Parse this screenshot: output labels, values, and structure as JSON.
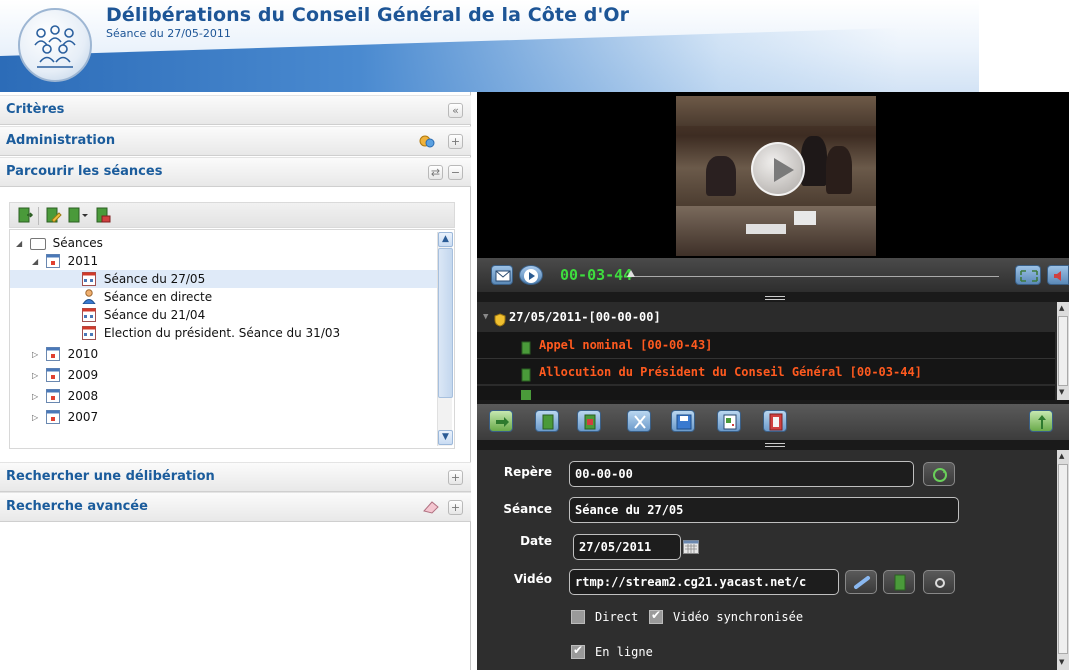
{
  "header": {
    "title": "Délibérations du Conseil Général de la Côte d'Or",
    "subtitle": "Séance du 27/05-2011"
  },
  "left_panel": {
    "criteres": {
      "title": "Critères",
      "collapse_icon": "double-chevron-left-icon"
    },
    "administration": {
      "title": "Administration"
    },
    "parcourir": {
      "title": "Parcourir les séances"
    },
    "tree": {
      "root": "Séances",
      "items": [
        {
          "label": "2011",
          "expanded": true
        },
        {
          "label": "Séance du 27/05",
          "selected": true
        },
        {
          "label": "Séance en directe"
        },
        {
          "label": "Séance du 21/04"
        },
        {
          "label": "Election du président. Séance du 31/03"
        },
        {
          "label": "2010"
        },
        {
          "label": "2009"
        },
        {
          "label": "2008"
        },
        {
          "label": "2007"
        }
      ]
    },
    "rechercher": {
      "title": "Rechercher une délibération"
    },
    "avancee": {
      "title": "Recherche avancée"
    }
  },
  "player": {
    "timecode": "00-03-44"
  },
  "marker_list": {
    "rows": [
      {
        "label": "27/05/2011-[00-00-00]",
        "color": "#ffffff"
      },
      {
        "label": "Appel nominal  [00-00-43]",
        "color": "#ff5a1f"
      },
      {
        "label": "Allocution du Président du Conseil Général  [00-03-44]",
        "color": "#ff5a1f"
      }
    ]
  },
  "form": {
    "repere_label": "Repère",
    "repere_value": "00-00-00",
    "seance_label": "Séance",
    "seance_value": "Séance du 27/05",
    "date_label": "Date",
    "date_value": "27/05/2011",
    "video_label": "Vidéo",
    "video_value": "rtmp://stream2.cg21.yacast.net/c",
    "direct_label": "Direct",
    "direct_checked": false,
    "synced_label": "Vidéo synchronisée",
    "synced_checked": true,
    "online_label": "En ligne",
    "online_checked": true
  },
  "colors": {
    "title_blue": "#1d5596",
    "section_blue": "#1b5c9c",
    "timecode_green": "#3edc3e",
    "list_orange": "#ff5a1f"
  }
}
